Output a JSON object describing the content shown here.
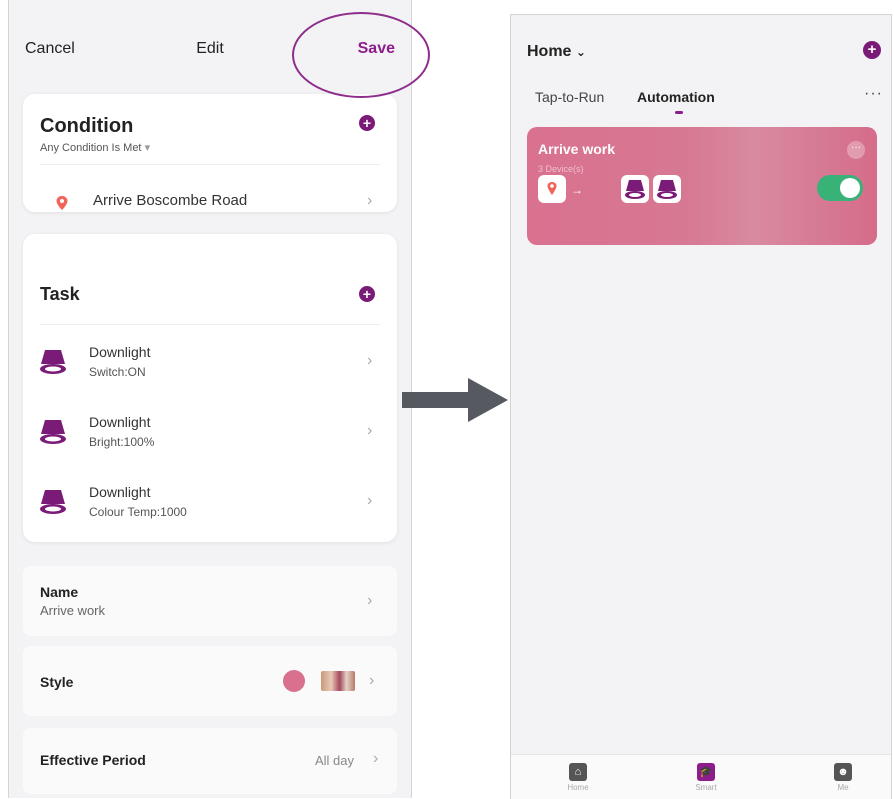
{
  "left_screen": {
    "nav": {
      "cancel": "Cancel",
      "title": "Edit",
      "save": "Save"
    },
    "condition": {
      "title": "Condition",
      "subtitle": "Any Condition Is Met",
      "items": [
        {
          "label": "Arrive Boscombe Road",
          "icon": "location-pin-icon"
        }
      ]
    },
    "task": {
      "title": "Task",
      "items": [
        {
          "name": "Downlight",
          "detail": "Switch:ON"
        },
        {
          "name": "Downlight",
          "detail": "Bright:100%"
        },
        {
          "name": "Downlight",
          "detail": "Colour Temp:1000"
        }
      ]
    },
    "name": {
      "label": "Name",
      "value": "Arrive work"
    },
    "style": {
      "label": "Style",
      "color": "#d9708e"
    },
    "effective_period": {
      "label": "Effective Period",
      "value": "All day"
    }
  },
  "right_screen": {
    "home": "Home",
    "tabs": [
      {
        "label": "Tap-to-Run"
      },
      {
        "label": "Automation"
      }
    ],
    "automation": {
      "title": "Arrive work",
      "subtitle": "3 Device(s)",
      "enabled": true
    },
    "tabbar": [
      {
        "label": "Home"
      },
      {
        "label": "Smart"
      },
      {
        "label": "Me"
      }
    ]
  },
  "colors": {
    "accent": "#8e1d8c",
    "toggle_on": "#39b278",
    "card": "#d9718f"
  }
}
